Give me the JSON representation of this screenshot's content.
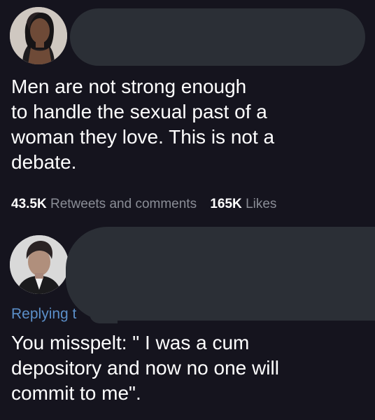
{
  "tweet1": {
    "text": "Men are not strong enough\nto handle the sexual past of a\nwoman they love. This is not a\ndebate.",
    "retweets_count": "43.5K",
    "retweets_label": "Retweets and comments",
    "likes_count": "165K",
    "likes_label": "Likes"
  },
  "tweet2": {
    "replying_to": "Replying t",
    "text": "You misspelt: \" I was a cum\ndepository and now no one will\ncommit to me\"."
  },
  "colors": {
    "background": "#15141e",
    "redaction": "#2b2f36",
    "link": "#5b8fc9",
    "muted": "#8a8d96"
  }
}
